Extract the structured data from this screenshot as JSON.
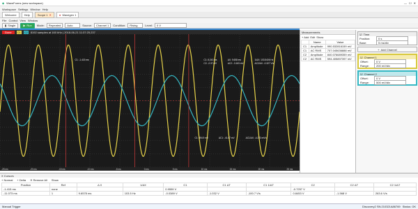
{
  "window": {
    "title": "WaveForms (new workspace)"
  },
  "menu": [
    "Workspace",
    "Settings",
    "Window",
    "Help"
  ],
  "tabs": {
    "welcome": "Welcome",
    "help": "Help",
    "scope": "Scope 1",
    "wavegen": "Wavegen 1"
  },
  "submenu": [
    "File",
    "Control",
    "View",
    "Window"
  ],
  "toolbar": {
    "single": "Single",
    "run": "Run",
    "mode_label": "Mode:",
    "mode_value": "Repeated",
    "auto_value": "Auto",
    "source_label": "Source:",
    "source_value": "Channel 1",
    "condition_label": "Condition:",
    "condition_value": "Rising",
    "level_label": "Level:",
    "level_value": "0 V"
  },
  "scope": {
    "done_label": "Done",
    "ch1_chip": "C1",
    "ch2_chip": "C2",
    "info": "8192 samples at 160 kHz | 2018-06-21 11:37:25.237",
    "xticks": [
      "-25 ms",
      "-20 ms",
      "-15 ms",
      "-10 ms",
      "-5 ms",
      "0 ms",
      "5 ms",
      "10 ms",
      "15 ms",
      "20 ms",
      "25 ms"
    ],
    "cursor_readouts": {
      "a": "C1: -1.415 ms",
      "b_c1": "C1: 8.243 ms",
      "b_dx": "ΔX: 9.658 ms",
      "b_freq": "1/ΔX: 103.5406 Hz",
      "b_c2": "C2: -2.37 mV",
      "b_dc2": "ΔC2: -3.163 mV",
      "b_slope": "ΔC2/ΔX: -0.327 V/s",
      "c_c1": "C1: 494.9 mV",
      "c_dc1": "ΔC1: -41.67 mV",
      "c_slope": "ΔC1/ΔX: -4.223 mV/s"
    }
  },
  "colors": {
    "ch1": "#e8d44a",
    "ch2": "#35b8c4",
    "cursor": "#d23b3b",
    "accent": "#3a8fdc"
  },
  "measurements": {
    "title": "Measurements",
    "add": "Add",
    "edit": "Edit",
    "show": "Show",
    "col_name": "Name",
    "col_value": "Value",
    "rows": [
      {
        "ch": "C1",
        "name": "Amplitude",
        "value": "990.532816159 mV"
      },
      {
        "ch": "C1",
        "name": "AC RMS",
        "value": "707.045636888 mV"
      },
      {
        "ch": "C2",
        "name": "Amplitude",
        "value": "840.076689359 mV"
      },
      {
        "ch": "C2",
        "name": "AC RMS",
        "value": "594.405897397 mV"
      }
    ]
  },
  "right_panel": {
    "time_label": "Time",
    "position_label": "Position:",
    "position_value": "0 s",
    "base_label": "Base:",
    "base_value": "5 ms/div",
    "add_channel": "Add Channel",
    "ch1": {
      "title": "Channel 1",
      "offset_label": "Offset:",
      "offset_value": "0 V",
      "range_label": "Range:",
      "range_value": "200 mV/div"
    },
    "ch2": {
      "title": "Channel 2",
      "offset_label": "Offset:",
      "offset_value": "0 V",
      "range_label": "Range:",
      "range_value": "500 mV/div"
    }
  },
  "cursors": {
    "title": "X Cursors",
    "normal": "Normal",
    "delta": "Delta",
    "remove_all": "Remove All",
    "show": "Show",
    "headers": [
      "Position",
      "Ref",
      "Δ X",
      "1/ΔX",
      "C1",
      "C1 ΔT",
      "C1 1/ΔT",
      "C2",
      "C2 ΔT",
      "C2 1/ΔT"
    ],
    "rows": [
      [
        "-1.415 ms",
        "none",
        "",
        "",
        "0.9559 V",
        "",
        "",
        "-0.7257 V",
        "",
        ""
      ],
      [
        "-11.073 ms",
        "1",
        "9.6578 ms",
        "103.5 Hz",
        "-0.0389 V",
        "-1.032 V",
        "-100.7 V/s",
        "0.8453 V",
        "-1.568 V",
        "263.6 V/s"
      ]
    ]
  },
  "status": {
    "left": "Manual Trigger",
    "device": "Discovery2 SN:210321A86769",
    "state": "Status: OK"
  }
}
